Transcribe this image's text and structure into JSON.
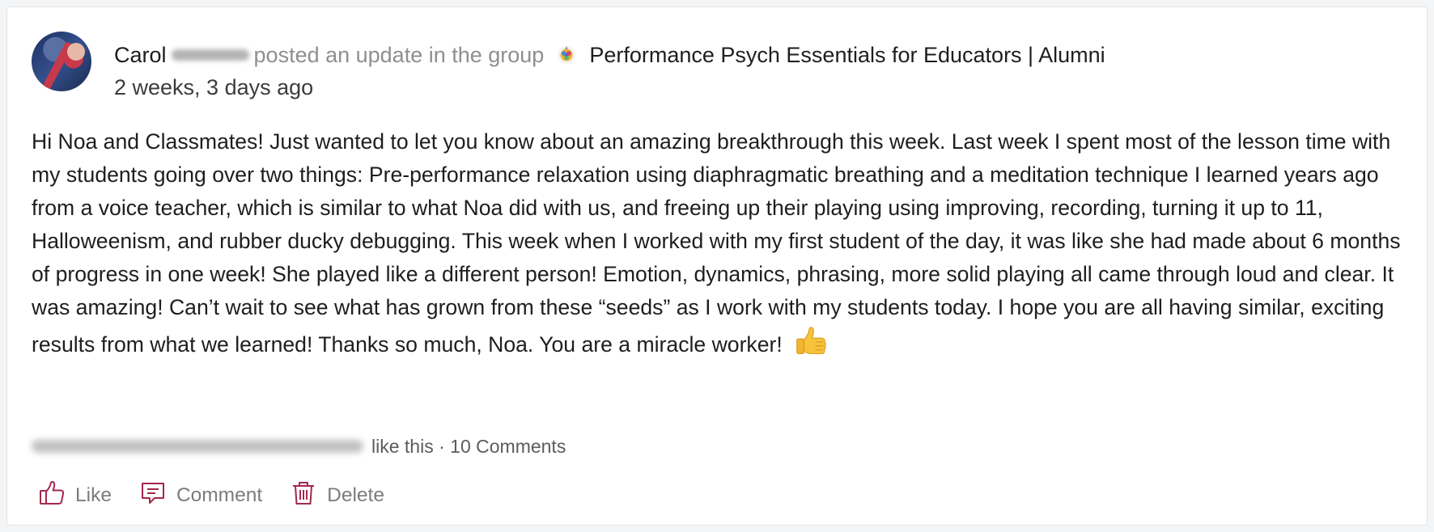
{
  "post": {
    "author": "Carol",
    "action_text": "posted an update in the group",
    "group_name": "Performance Psych Essentials for Educators | Alumni",
    "timestamp": "2 weeks, 3 days ago",
    "body": "Hi Noa and Classmates! Just wanted to let you know about an amazing breakthrough this week. Last week I spent most of the lesson time with my students going over two things: Pre-performance relaxation using diaphragmatic breathing and a meditation technique I learned years ago from a voice teacher, which is similar to what Noa did with us, and freeing up their playing using improving, recording, turning it up to 11, Halloweenism, and rubber ducky debugging. This week when I worked with my first student of the day, it was like she had made about 6 months of progress in one week! She played like a different person! Emotion, dynamics, phrasing, more solid playing all came through loud and clear. It was amazing! Can’t wait to see what has grown from these “seeds” as I work with my students today. I hope you are all having similar, exciting results from what we learned! Thanks so much, Noa. You are a miracle worker!",
    "emoji_icon": "thumbs-up-icon"
  },
  "engagement": {
    "likes_text": "like this",
    "separator": "·",
    "comments_text": "10 Comments"
  },
  "actions": {
    "like_label": "Like",
    "comment_label": "Comment",
    "delete_label": "Delete"
  },
  "colors": {
    "accent_icon": "#a5274b",
    "muted_text": "#8f8f8f",
    "body_text": "#1e1e1e"
  }
}
